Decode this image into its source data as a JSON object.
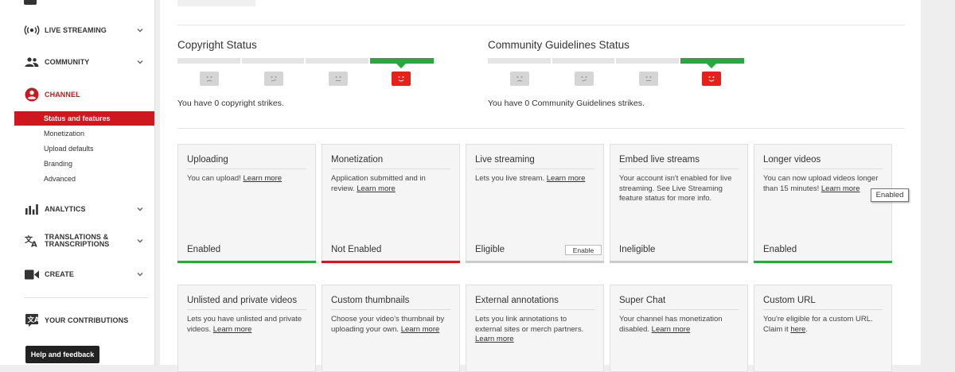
{
  "sidebar": {
    "items": [
      {
        "label": "Live Streaming",
        "icon": "live-streaming-icon"
      },
      {
        "label": "Community",
        "icon": "community-icon"
      },
      {
        "label": "Channel",
        "icon": "channel-icon"
      },
      {
        "label": "Analytics",
        "icon": "analytics-icon"
      },
      {
        "label": "Translations & Transcriptions",
        "icon": "translate-icon"
      },
      {
        "label": "Create",
        "icon": "create-icon"
      },
      {
        "label": "Your Contributions",
        "icon": "contributions-icon"
      }
    ],
    "channel_sub": [
      {
        "label": "Status and features",
        "active": true
      },
      {
        "label": "Monetization"
      },
      {
        "label": "Upload defaults"
      },
      {
        "label": "Branding"
      },
      {
        "label": "Advanced"
      }
    ],
    "help_label": "Help and feedback"
  },
  "copyright": {
    "title": "Copyright Status",
    "text": "You have 0 copyright strikes."
  },
  "guidelines": {
    "title": "Community Guidelines Status",
    "text": "You have 0 Community Guidelines strikes."
  },
  "cards": [
    {
      "title": "Uploading",
      "desc": "You can upload!",
      "link": "Learn more",
      "status": "Enabled"
    },
    {
      "title": "Monetization",
      "desc": "Application submitted and in review.",
      "link": "Learn more",
      "status": "Not Enabled"
    },
    {
      "title": "Live streaming",
      "desc": "Lets you live stream.",
      "link": "Learn more",
      "status": "Eligible",
      "button": "Enable"
    },
    {
      "title": "Embed live streams",
      "desc": "Your account isn't enabled for live streaming. See Live Streaming feature status for more info.",
      "status": "Ineligible"
    },
    {
      "title": "Longer videos",
      "desc": "You can now upload videos longer than 15 minutes!",
      "link": "Learn more",
      "status": "Enabled"
    },
    {
      "title": "Unlisted and private videos",
      "desc": "Lets you have unlisted and private videos.",
      "link": "Learn more"
    },
    {
      "title": "Custom thumbnails",
      "desc": "Choose your video's thumbnail by uploading your own.",
      "link": "Learn more"
    },
    {
      "title": "External annotations",
      "desc": "Lets you link annotations to external sites or merch partners.",
      "link": "Learn more"
    },
    {
      "title": "Super Chat",
      "desc": "Your channel has monetization disabled.",
      "link": "Learn more"
    },
    {
      "title": "Custom URL",
      "desc": "You're eligible for a custom URL. Claim it",
      "link": "here",
      "trail": "."
    }
  ],
  "tooltip": "Enabled",
  "colors": {
    "accent": "#cc181e",
    "enabled": "#2ba640",
    "not_enabled": "#cc181e",
    "ineligible": "#cccccc"
  }
}
